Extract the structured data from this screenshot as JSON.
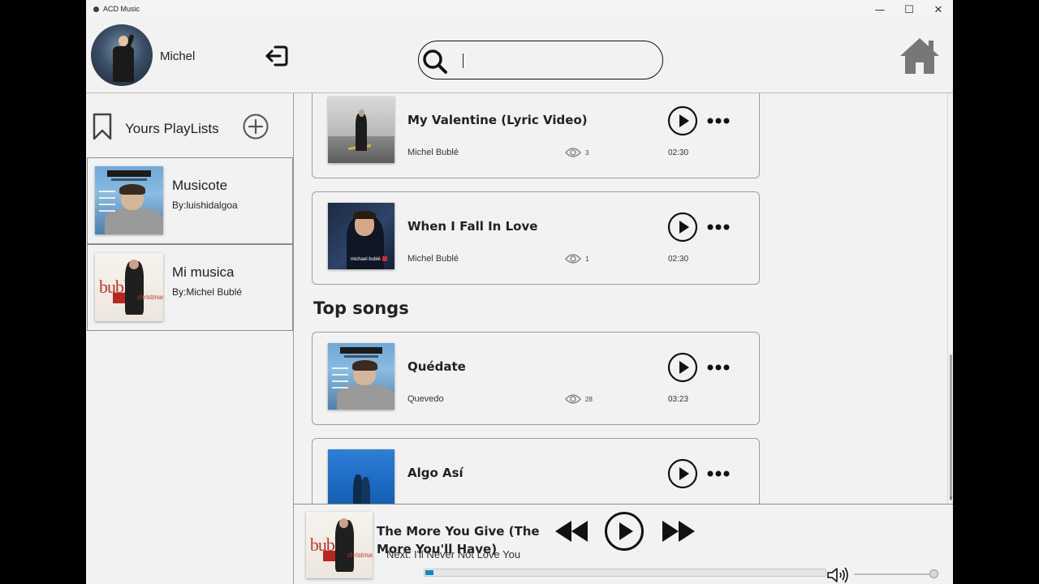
{
  "app": {
    "title": "ACD Music"
  },
  "window_controls": {
    "minimize": "—",
    "maximize": "☐",
    "close": "✕"
  },
  "header": {
    "username": "Michel",
    "search": {
      "value": "",
      "placeholder": ""
    }
  },
  "sidebar": {
    "title": "Yours PlayLists",
    "playlists": [
      {
        "name": "Musicote",
        "by": "By:luishidalgoa"
      },
      {
        "name": "Mi musica",
        "by": "By:Michel Bublé"
      }
    ]
  },
  "main": {
    "songs_top": [
      {
        "title": "My Valentine (Lyric Video)",
        "artist": "Michel Bublé",
        "views": "3",
        "duration": "02:30"
      },
      {
        "title": "When I Fall In Love",
        "artist": "Michel Bublé",
        "views": "1",
        "duration": "02:30"
      }
    ],
    "section_title": "Top songs",
    "top_songs": [
      {
        "title": "Quédate",
        "artist": "Quevedo",
        "views": "28",
        "duration": "03:23"
      },
      {
        "title": "Algo Así",
        "artist": "",
        "views": "",
        "duration": ""
      }
    ]
  },
  "player": {
    "now_playing": "The More You Give (The More You'll Have)",
    "next": "Next: I'll Never Not Love You",
    "progress_fraction": 0.02,
    "volume_fraction": 1.0
  },
  "colors": {
    "accent": "#1386c6",
    "background": "#f2f2f2",
    "border": "#9e9e9e"
  }
}
